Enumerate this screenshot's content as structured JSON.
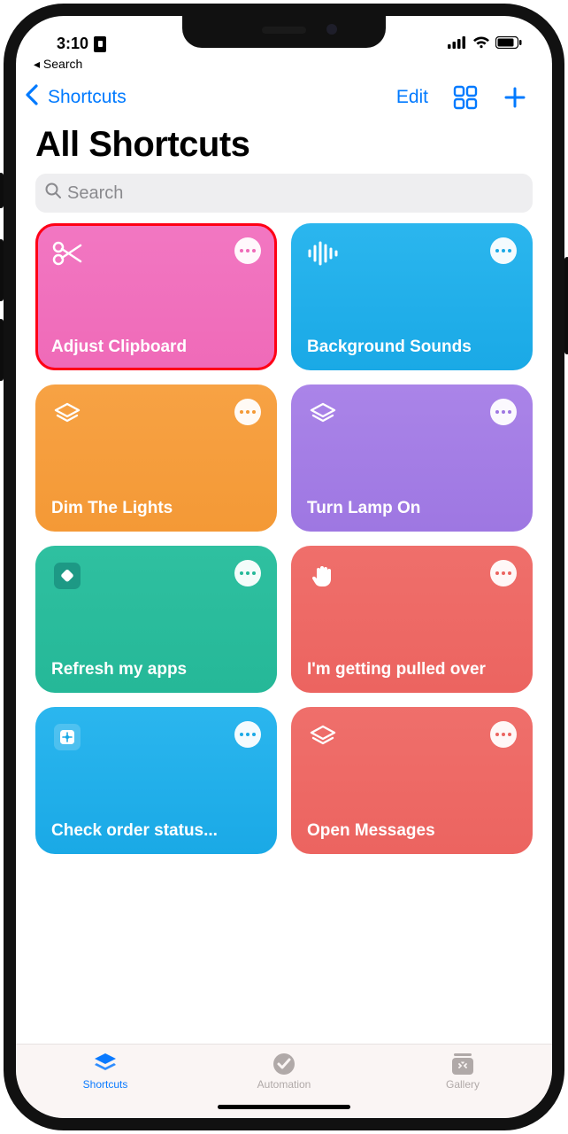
{
  "status": {
    "time": "3:10",
    "back_to_label": "◂ Search"
  },
  "nav": {
    "back_label": "Shortcuts",
    "edit_label": "Edit"
  },
  "page": {
    "title": "All Shortcuts"
  },
  "search": {
    "placeholder": "Search"
  },
  "tiles": [
    {
      "label": "Adjust Clipboard",
      "color": "c-pink",
      "icon": "scissors",
      "highlighted": true
    },
    {
      "label": "Background Sounds",
      "color": "c-blue",
      "icon": "waveform",
      "highlighted": false
    },
    {
      "label": "Dim The Lights",
      "color": "c-orange",
      "icon": "layers",
      "highlighted": false
    },
    {
      "label": "Turn Lamp On",
      "color": "c-purple",
      "icon": "layers",
      "highlighted": false
    },
    {
      "label": "Refresh my apps",
      "color": "c-teal",
      "icon": "diamond",
      "highlighted": false
    },
    {
      "label": "I'm getting pulled over",
      "color": "c-red",
      "icon": "hand",
      "highlighted": false
    },
    {
      "label": "Check order status...",
      "color": "c-blue2",
      "icon": "appstore",
      "highlighted": false
    },
    {
      "label": "Open Messages",
      "color": "c-red2",
      "icon": "layers",
      "highlighted": false
    }
  ],
  "tabs": {
    "shortcuts": "Shortcuts",
    "automation": "Automation",
    "gallery": "Gallery"
  }
}
